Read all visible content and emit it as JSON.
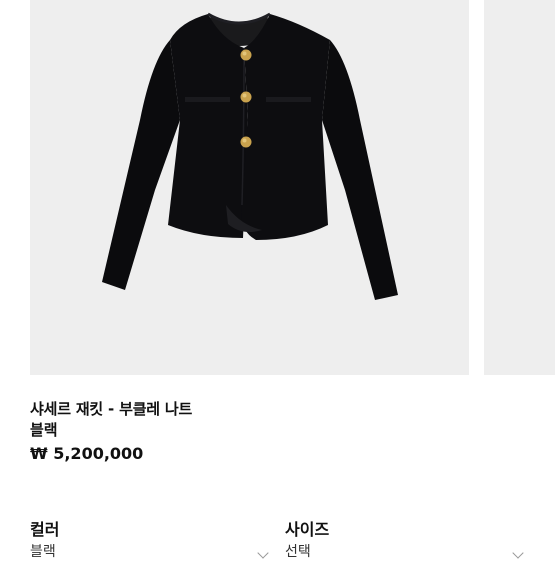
{
  "product": {
    "name": "샤세르 재킷 - 부클레 나트",
    "color": "블랙",
    "price": "₩ 5,200,000"
  },
  "options": {
    "color_label": "컬러",
    "color_value": "블랙",
    "size_label": "사이즈",
    "size_value": "선택"
  },
  "colors": {
    "image_bg": "#eeeeee",
    "jacket": "#0b0b0d",
    "buttons": "#c9a24e"
  },
  "icons": {
    "dropdown": "chevron-down-icon"
  }
}
